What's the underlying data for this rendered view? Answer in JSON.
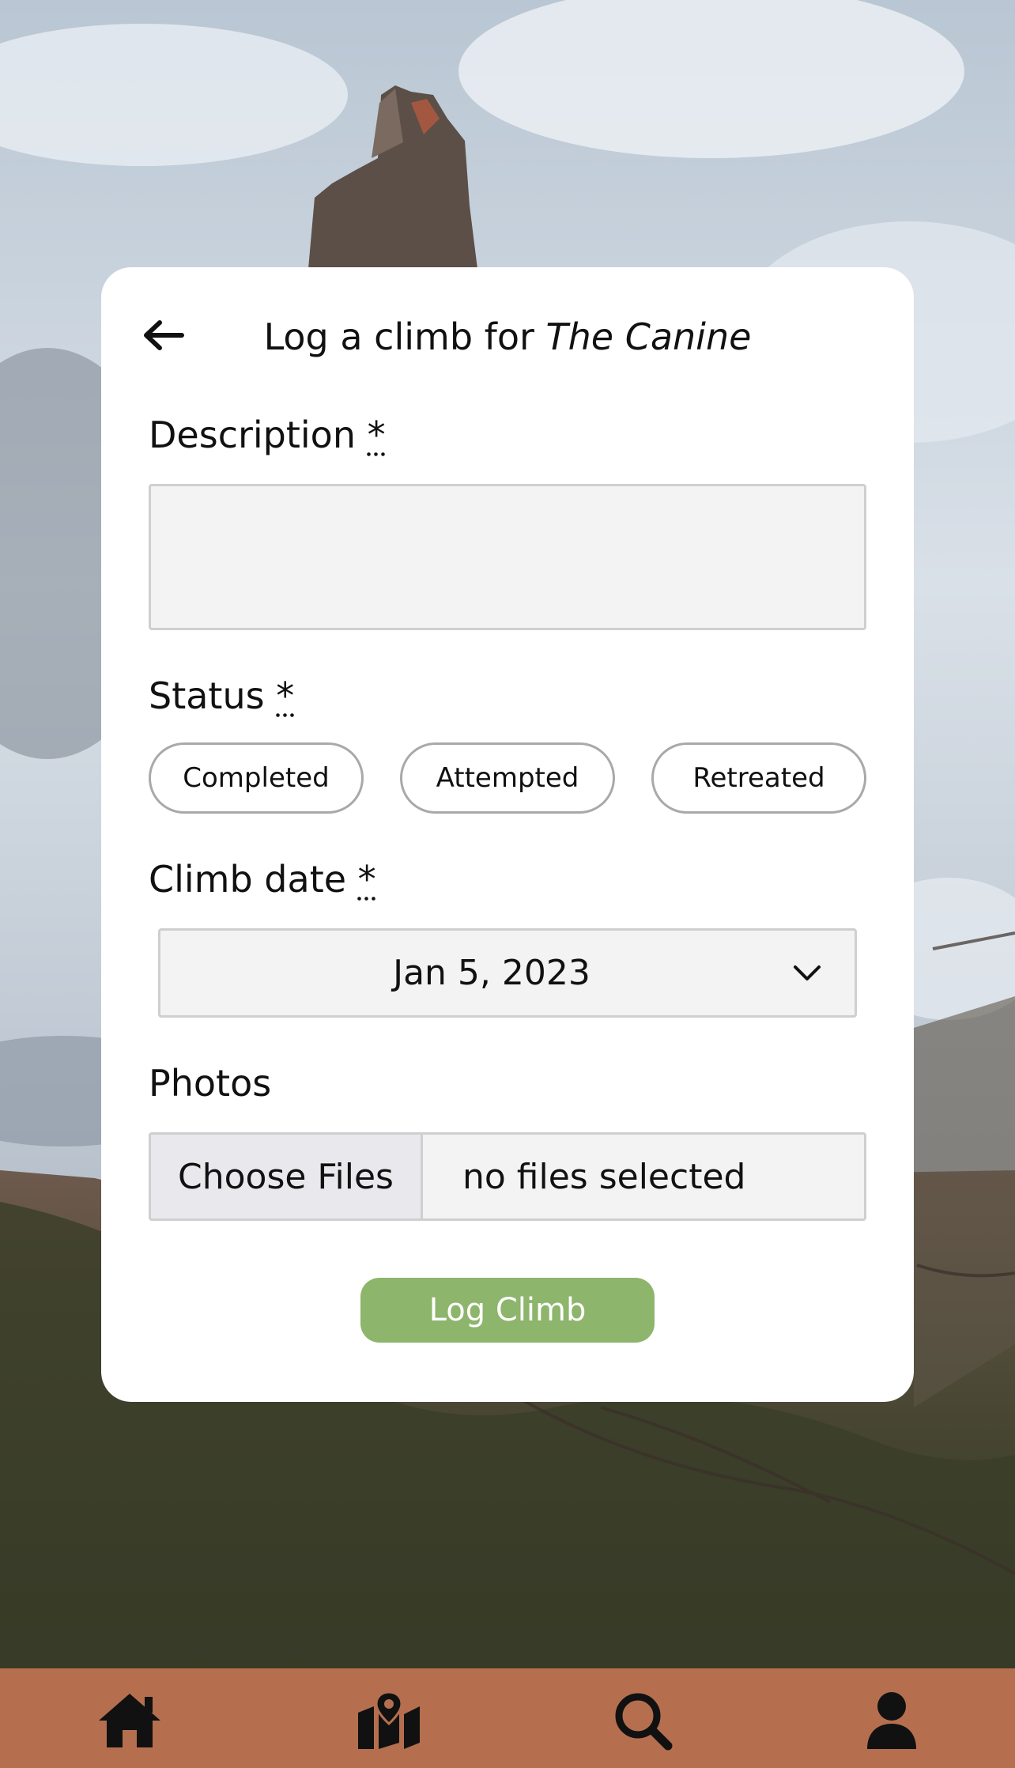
{
  "form": {
    "title_prefix": "Log a climb for ",
    "route_name": "The Canine",
    "description": {
      "label": "Description",
      "required_mark": "*",
      "value": ""
    },
    "status": {
      "label": "Status",
      "required_mark": "*",
      "options": [
        "Completed",
        "Attempted",
        "Retreated"
      ]
    },
    "climb_date": {
      "label": "Climb date",
      "required_mark": "*",
      "value": "Jan 5, 2023"
    },
    "photos": {
      "label": "Photos",
      "button_label": "Choose Files",
      "status_text": "no files selected"
    },
    "submit_label": "Log Climb"
  },
  "nav": {
    "items": [
      {
        "id": "home",
        "icon": "home-icon"
      },
      {
        "id": "map",
        "icon": "map-icon"
      },
      {
        "id": "search",
        "icon": "search-icon"
      },
      {
        "id": "profile",
        "icon": "user-icon"
      }
    ]
  },
  "colors": {
    "accent_green": "#8db56c",
    "nav_background": "#b56f4f",
    "card_background": "#ffffff"
  }
}
